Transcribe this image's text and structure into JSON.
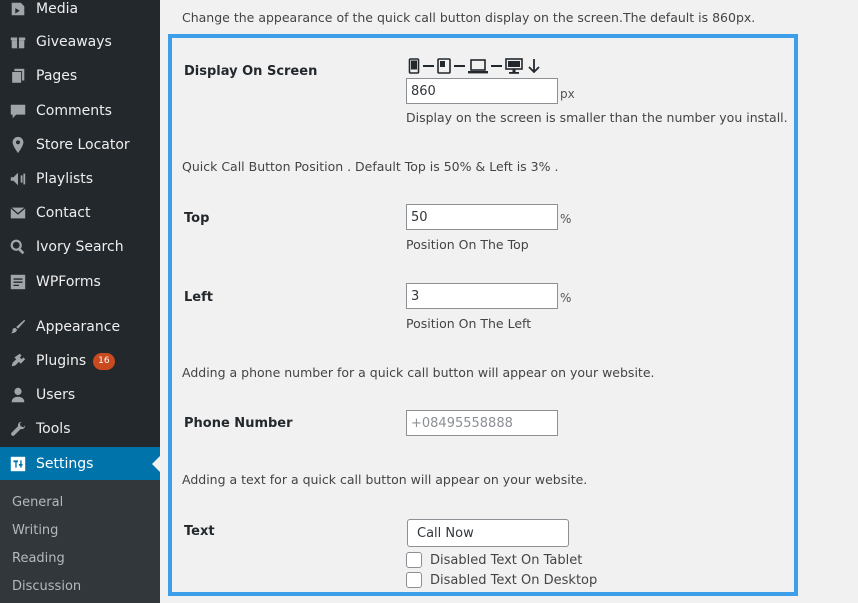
{
  "sidebar": {
    "items": [
      {
        "label": "Media",
        "icon": "media-icon"
      },
      {
        "label": "Giveaways",
        "icon": "gift-icon"
      },
      {
        "label": "Pages",
        "icon": "pages-icon"
      },
      {
        "label": "Comments",
        "icon": "comments-icon"
      },
      {
        "label": "Store Locator",
        "icon": "location-pin-icon"
      },
      {
        "label": "Playlists",
        "icon": "playlist-icon"
      },
      {
        "label": "Contact",
        "icon": "envelope-icon"
      },
      {
        "label": "Ivory Search",
        "icon": "search-icon"
      },
      {
        "label": "WPForms",
        "icon": "forms-icon"
      },
      {
        "label": "Appearance",
        "icon": "brush-icon"
      },
      {
        "label": "Plugins",
        "icon": "plugin-icon",
        "badge": "16"
      },
      {
        "label": "Users",
        "icon": "user-icon"
      },
      {
        "label": "Tools",
        "icon": "wrench-icon"
      },
      {
        "label": "Settings",
        "icon": "settings-icon",
        "active": true
      }
    ],
    "submenu": [
      "General",
      "Writing",
      "Reading",
      "Discussion"
    ]
  },
  "main": {
    "top_note": "Change the appearance of the quick call button display on the screen.The default is 860px.",
    "display": {
      "label": "Display On Screen",
      "value": "860",
      "unit": "px",
      "desc": "Display on the screen is smaller than the number you install."
    },
    "position_note": "Quick Call Button Position . Default Top is 50% & Left is 3% .",
    "top": {
      "label": "Top",
      "value": "50",
      "unit": "%",
      "desc": "Position On The Top"
    },
    "left": {
      "label": "Left",
      "value": "3",
      "unit": "%",
      "desc": "Position On The Left"
    },
    "phone_note": "Adding a phone number for a quick call button will appear on your website.",
    "phone": {
      "label": "Phone Number",
      "placeholder": "+08495558888"
    },
    "text_note": "Adding a text for a quick call button will appear on your website.",
    "text": {
      "label": "Text",
      "value": "Call Now",
      "checkbox_tablet": "Disabled Text On Tablet",
      "checkbox_desktop": "Disabled Text On Desktop"
    }
  },
  "colors": {
    "sidebar_bg": "#23282d",
    "active": "#0073aa",
    "frame_border": "#3d9eea",
    "badge": "#ca4a1f"
  }
}
